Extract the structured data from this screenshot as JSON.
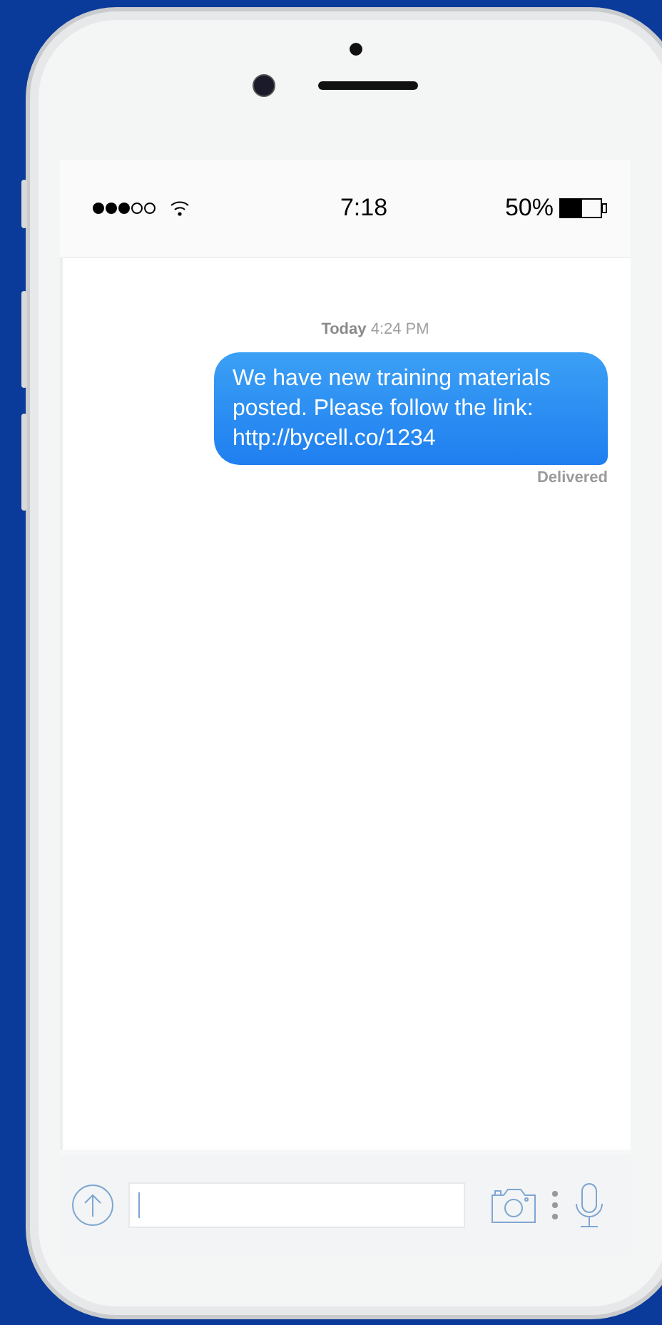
{
  "status_bar": {
    "time": "7:18",
    "battery_text": "50%"
  },
  "conversation": {
    "timestamp": "**Today** 4:24 PM",
    "messages": [
      {
        "kind": "sent",
        "text": "We have new training materials posted. Please follow the link: http://bycell.co/1234",
        "status": "Delivered"
      }
    ]
  }
}
